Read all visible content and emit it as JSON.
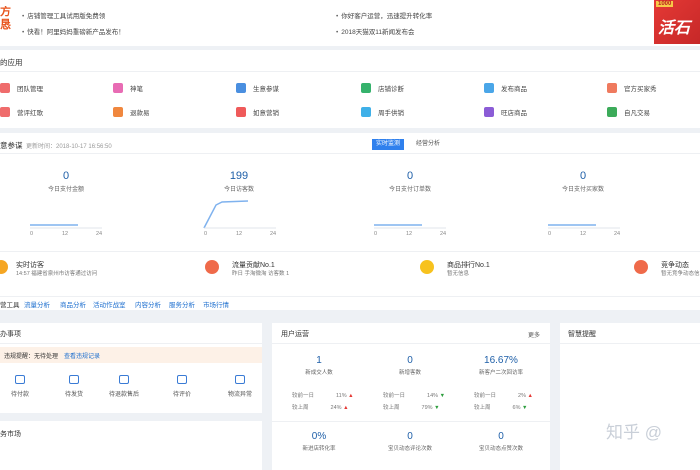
{
  "announcements": {
    "left_promo": "方\n恳",
    "items": [
      "店铺管理工具试用版免费领",
      "快看！阿里妈妈重磅新产品发布！",
      "你好客户运营，迅速提升转化率",
      "2018天猫双11新闻发布会"
    ],
    "banner_top": "1000",
    "banner_main": "活石"
  },
  "apps": {
    "title": "的应用",
    "items": [
      {
        "label": "团队管理",
        "color": "#ef6c6c"
      },
      {
        "label": "神笔",
        "color": "#e86cb4"
      },
      {
        "label": "生意参谋",
        "color": "#4a8fe0"
      },
      {
        "label": "店铺诊断",
        "color": "#35b26c"
      },
      {
        "label": "发布商品",
        "color": "#4aa6e8"
      },
      {
        "label": "官方买家秀",
        "color": "#ef7a5e"
      },
      {
        "label": "营评红歌",
        "color": "#ef6c6c"
      },
      {
        "label": "退款易",
        "color": "#f0873e"
      },
      {
        "label": "如意营销",
        "color": "#ef5a5a"
      },
      {
        "label": "周手供销",
        "color": "#3fb0e8"
      },
      {
        "label": "旺店商品",
        "color": "#8b5cd6"
      },
      {
        "label": "自凡交易",
        "color": "#3cab5a"
      }
    ]
  },
  "stats": {
    "title": "意参谋",
    "updated": "更新时间：2018-10-17 16:56:50",
    "tabs": [
      "实时监测",
      "经营分析"
    ],
    "kpis": [
      {
        "value": "0",
        "caption": "今日支付金额"
      },
      {
        "value": "199",
        "caption": "今日访客数"
      },
      {
        "value": "0",
        "caption": "今日支付订单数"
      },
      {
        "value": "0",
        "caption": "今日支付买家数"
      }
    ],
    "axis": [
      "0",
      "12",
      "24"
    ],
    "insights": [
      {
        "title": "实时访客",
        "sub": "14:57 福建省泉州市访客通过访问"
      },
      {
        "title": "流量贡献No.1",
        "sub": "昨日 手淘微淘 访客数 1"
      },
      {
        "title": "商品排行No.1",
        "sub": "暂无信息"
      },
      {
        "title": "竞争动态",
        "sub": "暂无竞争动态信息"
      }
    ],
    "tool_tabs": [
      "营工具",
      "流量分析",
      "商品分析",
      "活动作战室",
      "内容分析",
      "服务分析",
      "市场行情"
    ]
  },
  "todo": {
    "title": "办事项",
    "alert_label": "违规提醒：无待处理",
    "alert_link": "查看违规记录",
    "actions": [
      "待付款",
      "待发货",
      "待退款售后",
      "待评价",
      "物流异常"
    ]
  },
  "user_ops": {
    "title": "用户运营",
    "more": "更多",
    "metrics": [
      {
        "value": "1",
        "caption": "新成交人数",
        "d1": "11%",
        "d1dir": "up",
        "d2": "24%",
        "d2dir": "up"
      },
      {
        "value": "0",
        "caption": "新增客数",
        "d1": "14%",
        "d1dir": "down",
        "d2": "79%",
        "d2dir": "down"
      },
      {
        "value": "16.67%",
        "caption": "新客户二次回访率",
        "d1": "2%",
        "d1dir": "up",
        "d2": "6%",
        "d2dir": "down"
      }
    ],
    "cmp_labels": [
      "较前一日",
      "较上周"
    ],
    "metrics2": [
      {
        "value": "0%",
        "caption": "新进店转化率"
      },
      {
        "value": "0",
        "caption": "宝贝动态评论次数"
      },
      {
        "value": "0",
        "caption": "宝贝动态点赞次数"
      }
    ]
  },
  "smart": {
    "title": "智慧提醒"
  },
  "service_market": {
    "title": "务市场"
  },
  "watermark": "知乎 @"
}
